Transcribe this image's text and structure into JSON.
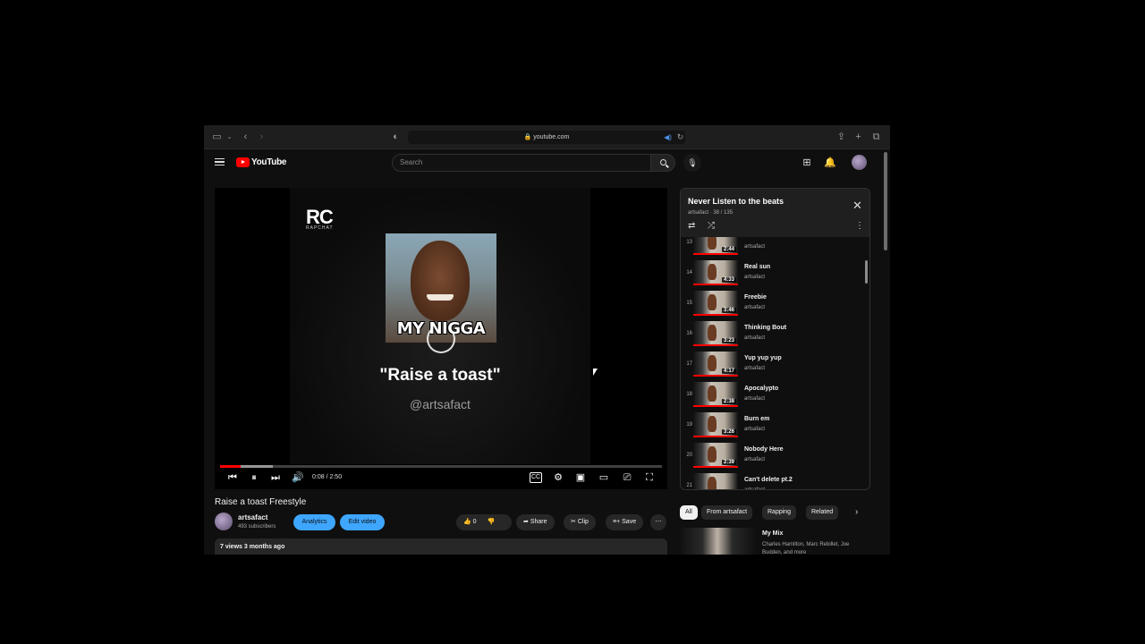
{
  "browser": {
    "url": "youtube.com"
  },
  "header": {
    "logo_text": "YouTube",
    "search_placeholder": "Search"
  },
  "video": {
    "overlay_logo": "RC",
    "overlay_logo_sub": "RAPCHAT",
    "meme_caption": "MY NIGGA",
    "quote": "\"Raise a toast\"",
    "handle": "@artsafact",
    "time": "0:08 / 2:50",
    "progress_played": 0.047,
    "progress_buffered": 0.12
  },
  "info": {
    "title": "Raise a toast Freestyle",
    "channel": "artsafact",
    "subscribers": "493 subscribers",
    "analytics_label": "Analytics",
    "edit_label": "Edit video",
    "likes": "0",
    "share_label": "Share",
    "clip_label": "Clip",
    "save_label": "Save",
    "views_date": "7 views  3 months ago"
  },
  "playlist": {
    "title": "Never Listen to the beats",
    "subtitle": "artsafact · 38 / 135",
    "items": [
      {
        "index": "13",
        "title": "",
        "channel": "artsafact",
        "duration": "2:44"
      },
      {
        "index": "14",
        "title": "Real sun",
        "channel": "artsafact",
        "duration": "4:33"
      },
      {
        "index": "15",
        "title": "Freebie",
        "channel": "artsafact",
        "duration": "3:46"
      },
      {
        "index": "16",
        "title": "Thinking Bout",
        "channel": "artsafact",
        "duration": "3:23"
      },
      {
        "index": "17",
        "title": "Yup yup yup",
        "channel": "artsafact",
        "duration": "4:17"
      },
      {
        "index": "18",
        "title": "Apocalypto",
        "channel": "artsafact",
        "duration": "2:38"
      },
      {
        "index": "19",
        "title": "Burn em",
        "channel": "artsafact",
        "duration": "3:26"
      },
      {
        "index": "20",
        "title": "Nobody Here",
        "channel": "artsafact",
        "duration": "2:39"
      },
      {
        "index": "21",
        "title": "Can't delete pt.2",
        "channel": "artsafact",
        "duration": ""
      }
    ]
  },
  "chips": [
    "All",
    "From artsafact",
    "Rapping",
    "Related"
  ],
  "mix": {
    "title": "My Mix",
    "subtitle": "Charles Hamilton, Marc Rebillet, Joe Budden, and more"
  },
  "colors": {
    "accent_red": "#ff0000",
    "button_blue": "#3ea6ff",
    "background": "#0f0f0f"
  }
}
